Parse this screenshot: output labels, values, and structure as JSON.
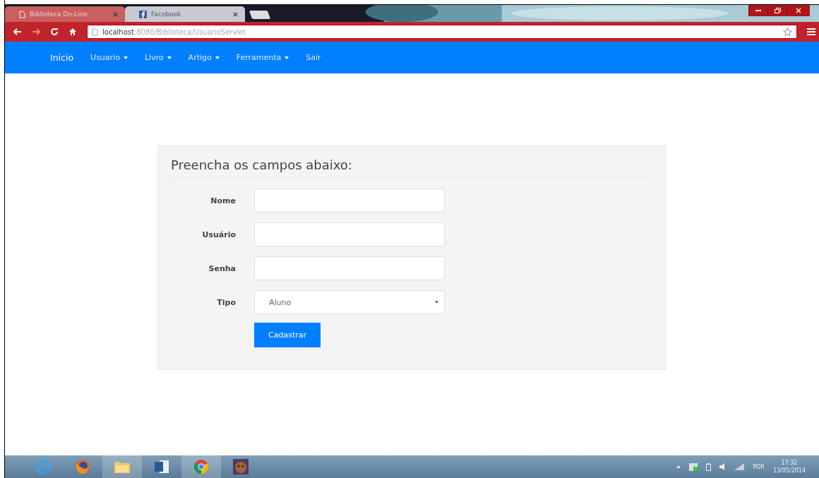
{
  "browser": {
    "tabs": [
      {
        "title": "Biblioteca On-Line",
        "selected": true
      },
      {
        "title": "Facebook",
        "selected": false
      }
    ],
    "address": {
      "host": "localhost",
      "path": ":8080/Biblioteca/UsuarioServlet"
    }
  },
  "navbar": {
    "items": [
      {
        "label": "Inicio",
        "dropdown": false,
        "selected": true
      },
      {
        "label": "Usuario",
        "dropdown": true,
        "selected": false
      },
      {
        "label": "Livro",
        "dropdown": true,
        "selected": false
      },
      {
        "label": "Artigo",
        "dropdown": true,
        "selected": false
      },
      {
        "label": "Ferramenta",
        "dropdown": true,
        "selected": false
      },
      {
        "label": "Sair",
        "dropdown": false,
        "selected": false
      }
    ]
  },
  "form": {
    "title": "Preencha os campos abaixo:",
    "fields": [
      {
        "label": "Nome",
        "kind": "text"
      },
      {
        "label": "Usuário",
        "kind": "text"
      },
      {
        "label": "Senha",
        "kind": "password"
      },
      {
        "label": "Tipo",
        "kind": "select",
        "value": "Aluno"
      }
    ],
    "submit": "Cadastrar"
  },
  "taskbar": {
    "language": "POR",
    "time": "17:32",
    "date": "13/05/2014"
  }
}
